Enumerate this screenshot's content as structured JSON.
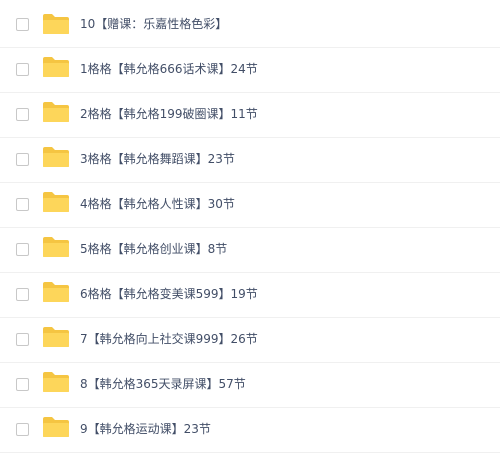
{
  "files": [
    {
      "name": "10【赠课：乐嘉性格色彩】",
      "icon": "folder-icon"
    },
    {
      "name": "1格格【韩允格666话术课】24节",
      "icon": "folder-icon"
    },
    {
      "name": "2格格【韩允格199破圈课】11节",
      "icon": "folder-icon"
    },
    {
      "name": "3格格【韩允格舞蹈课】23节",
      "icon": "folder-icon"
    },
    {
      "name": "4格格【韩允格人性课】30节",
      "icon": "folder-icon"
    },
    {
      "name": "5格格【韩允格创业课】8节",
      "icon": "folder-icon"
    },
    {
      "name": "6格格【韩允格变美课599】19节",
      "icon": "folder-icon"
    },
    {
      "name": "7【韩允格向上社交课999】26节",
      "icon": "folder-icon"
    },
    {
      "name": "8【韩允格365天录屏课】57节",
      "icon": "folder-icon"
    },
    {
      "name": "9【韩允格运动课】23节",
      "icon": "folder-icon"
    }
  ],
  "colors": {
    "folder_back": "#f5c542",
    "folder_front": "#fdd65a",
    "text": "#424e67",
    "checkbox_border": "#c8c8c8"
  }
}
